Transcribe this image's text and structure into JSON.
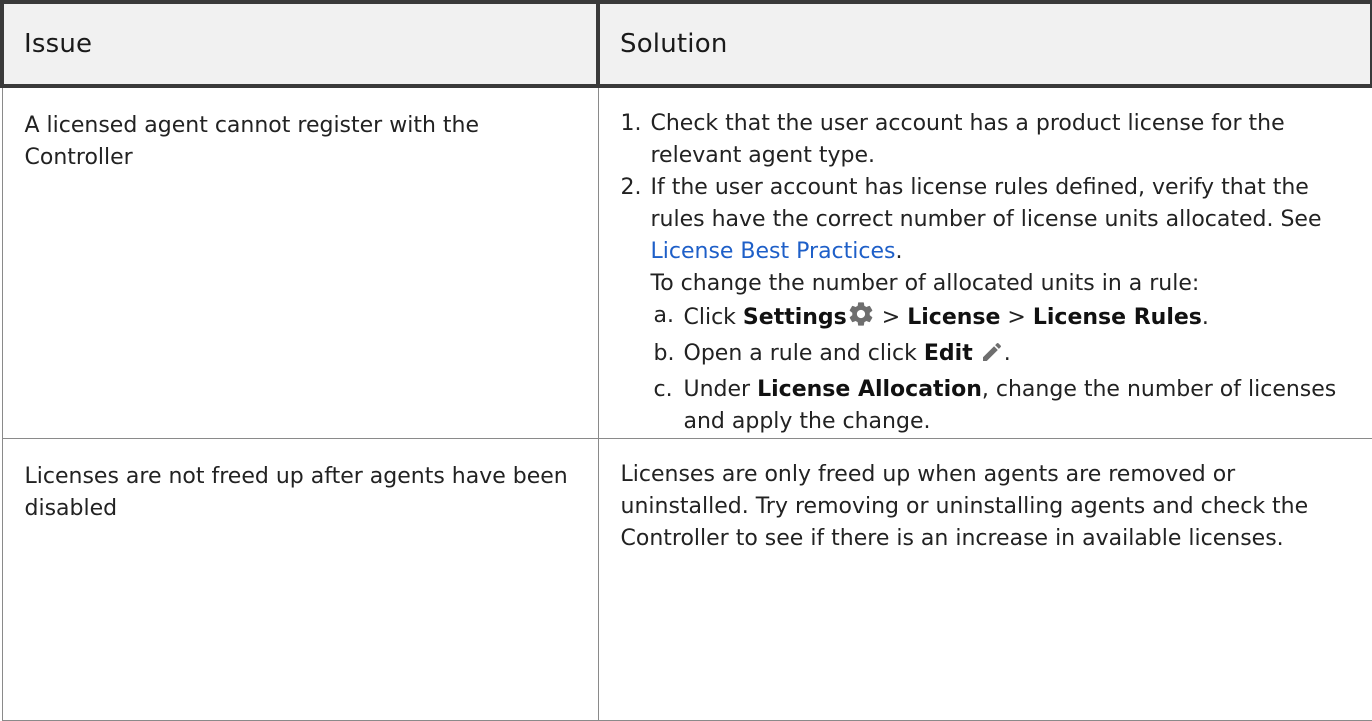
{
  "table": {
    "headers": {
      "issue": "Issue",
      "solution": "Solution"
    },
    "rows": [
      {
        "issue": "A licensed agent cannot register with the Controller",
        "steps": [
          {
            "num": "1.",
            "text": "Check that the user account has a product license for the relevant agent type."
          },
          {
            "num": "2.",
            "text_before_link": "If the user account has license rules defined, verify that the rules have the correct number of license units allocated. See ",
            "link": "License Best Practices",
            "text_after_link": ".",
            "note": "To change the number of allocated units in a rule:",
            "substeps": [
              {
                "letter": "a.",
                "click": "Click",
                "settings": "Settings",
                "sep1": ">",
                "license": "License",
                "sep2": ">",
                "license_rules": "License Rules",
                "end": "."
              },
              {
                "letter": "b.",
                "open_text": "Open a rule and click",
                "edit": "Edit",
                "end": "."
              },
              {
                "letter": "c.",
                "under": "Under",
                "allocation": "License Allocation",
                "rest": ", change the number of licenses and apply the change."
              }
            ]
          }
        ]
      },
      {
        "issue": "Licenses are not freed up after agents have been disabled",
        "solution": "Licenses are only freed up when agents are removed or uninstalled. Try removing or uninstalling agents and check the Controller to see if there is an increase in available licenses."
      }
    ]
  },
  "icons": {
    "settings": "gear-icon",
    "edit": "pencil-icon"
  },
  "colors": {
    "link": "#1e5fc8",
    "header_bg": "#f1f1f1",
    "icon": "#6e6e6e"
  }
}
